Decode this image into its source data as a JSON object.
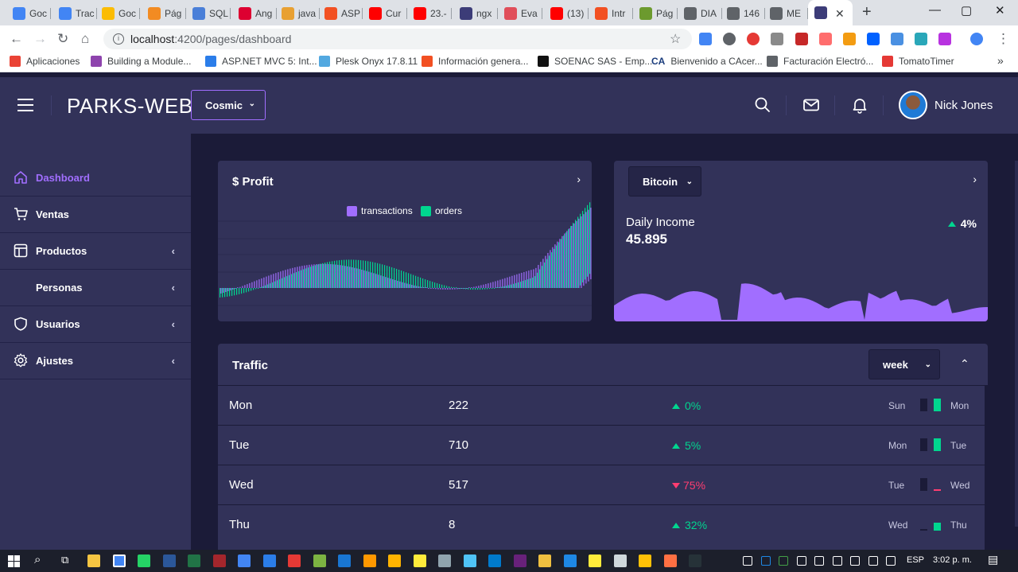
{
  "browser": {
    "tabs": [
      {
        "label": "Goc",
        "color": "#4285f4"
      },
      {
        "label": "Trac",
        "color": "#4285f4"
      },
      {
        "label": "Goc",
        "color": "#fbbc04"
      },
      {
        "label": "Pág",
        "color": "#f28b22"
      },
      {
        "label": "SQL",
        "color": "#4a7fd8"
      },
      {
        "label": "Ang",
        "color": "#dd0031"
      },
      {
        "label": "java",
        "color": "#e8a032"
      },
      {
        "label": "ASP",
        "color": "#f25022"
      },
      {
        "label": "Cur",
        "color": "#ff0000"
      },
      {
        "label": "23.-",
        "color": "#ff0000"
      },
      {
        "label": "ngx",
        "color": "#3c3c78"
      },
      {
        "label": "Eva",
        "color": "#e04e5a"
      },
      {
        "label": "(13)",
        "color": "#ff0000"
      },
      {
        "label": "Intr",
        "color": "#f25022"
      },
      {
        "label": "Pág",
        "color": "#6c9a2e"
      },
      {
        "label": "DIA",
        "color": "#5f6368"
      },
      {
        "label": "146",
        "color": "#5f6368"
      },
      {
        "label": "ME",
        "color": "#5f6368"
      }
    ],
    "active_tab_color": "#3c3c78",
    "tab_close": "✕",
    "new_tab": "+",
    "window_controls": {
      "minimize": "—",
      "maximize": "▢",
      "close": "✕"
    },
    "url_host": "localhost",
    "url_path": ":4200/pages/dashboard",
    "bookmarks": [
      {
        "label": "Aplicaciones",
        "color": "#ea4335"
      },
      {
        "label": "Building a Module...",
        "color": "#8e44ad"
      },
      {
        "label": "ASP.NET MVC 5: Int...",
        "color": "#2b7de9"
      },
      {
        "label": "Plesk Onyx 17.8.11",
        "color": "#52a8e0"
      },
      {
        "label": "Información genera...",
        "color": "#f25022"
      },
      {
        "label": "SOENAC SAS - Emp...",
        "color": "#111111"
      },
      {
        "label": "Bienvenido a CAcer...",
        "color": "#1a3c7c",
        "prefix": "CA"
      },
      {
        "label": "Facturación Electró...",
        "color": "#5f6368"
      },
      {
        "label": "TomatoTimer",
        "color": "#e53935"
      }
    ],
    "bookmarks_more": "»"
  },
  "header": {
    "brand": "PARKS-WEB",
    "theme": "Cosmic",
    "user_name": "Nick Jones"
  },
  "sidebar": {
    "items": [
      {
        "label": "Dashboard",
        "icon": "home-icon",
        "active": true,
        "arrow": ""
      },
      {
        "label": "Ventas",
        "icon": "cart-icon",
        "arrow": ""
      },
      {
        "label": "Productos",
        "icon": "layout-icon",
        "arrow": "‹"
      },
      {
        "label": "Personas",
        "icon": "",
        "arrow": "‹"
      },
      {
        "label": "Usuarios",
        "icon": "shield-icon",
        "arrow": "‹"
      },
      {
        "label": "Ajustes",
        "icon": "settings-icon",
        "arrow": "‹"
      }
    ]
  },
  "profit": {
    "title": "$ Profit",
    "legend": [
      {
        "name": "transactions",
        "color": "#a16eff"
      },
      {
        "name": "orders",
        "color": "#00d68f"
      }
    ]
  },
  "bitcoin": {
    "selected": "Bitcoin",
    "label": "Daily Income",
    "value": "45.895",
    "delta": "4%",
    "accent": "#a16eff"
  },
  "traffic": {
    "title": "Traffic",
    "period": "week",
    "rows": [
      {
        "day": "Mon",
        "value": "222",
        "delta": "0%",
        "trend": "up",
        "prev": "Sun",
        "cur": "Mon"
      },
      {
        "day": "Tue",
        "value": "710",
        "delta": "5%",
        "trend": "up",
        "prev": "Mon",
        "cur": "Tue"
      },
      {
        "day": "Wed",
        "value": "517",
        "delta": "75%",
        "trend": "down",
        "prev": "Tue",
        "cur": "Wed"
      },
      {
        "day": "Thu",
        "value": "8",
        "delta": "32%",
        "trend": "up",
        "prev": "Wed",
        "cur": "Thu"
      }
    ],
    "colors": {
      "up": "#00d68f",
      "down": "#ff3d71"
    }
  },
  "taskbar": {
    "lang": "ESP",
    "time": "3:02 p. m."
  }
}
